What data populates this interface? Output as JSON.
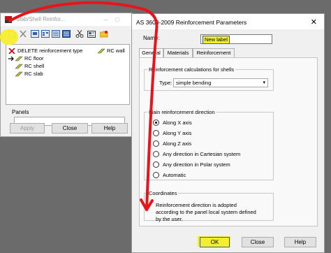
{
  "left_window": {
    "title": "Slab/Shell Reinfor...",
    "tree_items": [
      {
        "label": "DELETE reinforcement type",
        "icon": "red-x-icon",
        "color": "#c0000a"
      },
      {
        "label": "RC floor",
        "icon": "rc-pencil-icon",
        "color": "#6b7a10"
      },
      {
        "label": "RC shell",
        "icon": "rc-pencil-icon",
        "color": "#6b7a10"
      },
      {
        "label": "RC slab",
        "icon": "rc-pencil-icon",
        "color": "#6b7a10"
      },
      {
        "label": "RC wall",
        "icon": "rc-pencil-icon",
        "color": "#6b7a10"
      }
    ],
    "panels_label": "Panels",
    "panels_value": "",
    "buttons": {
      "apply": "Apply",
      "close": "Close",
      "help": "Help"
    }
  },
  "right_window": {
    "title": "AS 3600-2009 Reinforcement Parameters",
    "close_glyph": "✕",
    "name_label": "Name:",
    "name_value": "New label",
    "tabs": [
      "General",
      "Materials",
      "Reinforcement"
    ],
    "active_tab": "General",
    "shell_group": {
      "title": "Reinforcement calculations for shells",
      "type_label": "Type:",
      "type_value": "simple bending"
    },
    "direction_group": {
      "title": "Main reinforcement direction",
      "options": [
        {
          "label": "Along X axis",
          "selected": true
        },
        {
          "label": "Along Y axis",
          "selected": false
        },
        {
          "label": "Along Z axis",
          "selected": false
        },
        {
          "label": "Any direction in Cartesian system",
          "selected": false
        },
        {
          "label": "Any direction in Polar system",
          "selected": false
        },
        {
          "label": "Automatic",
          "selected": false
        }
      ]
    },
    "coordinates_group": {
      "title": "Coordinates",
      "text": "Reinforcement direction is adopted according to the panel local system defined by the user."
    },
    "buttons": {
      "ok": "OK",
      "close": "Close",
      "help": "Help"
    }
  },
  "colors": {
    "highlight_yellow": "#f4ee2e",
    "annotation_red": "#e8141c",
    "background": "#6b6b6b"
  }
}
